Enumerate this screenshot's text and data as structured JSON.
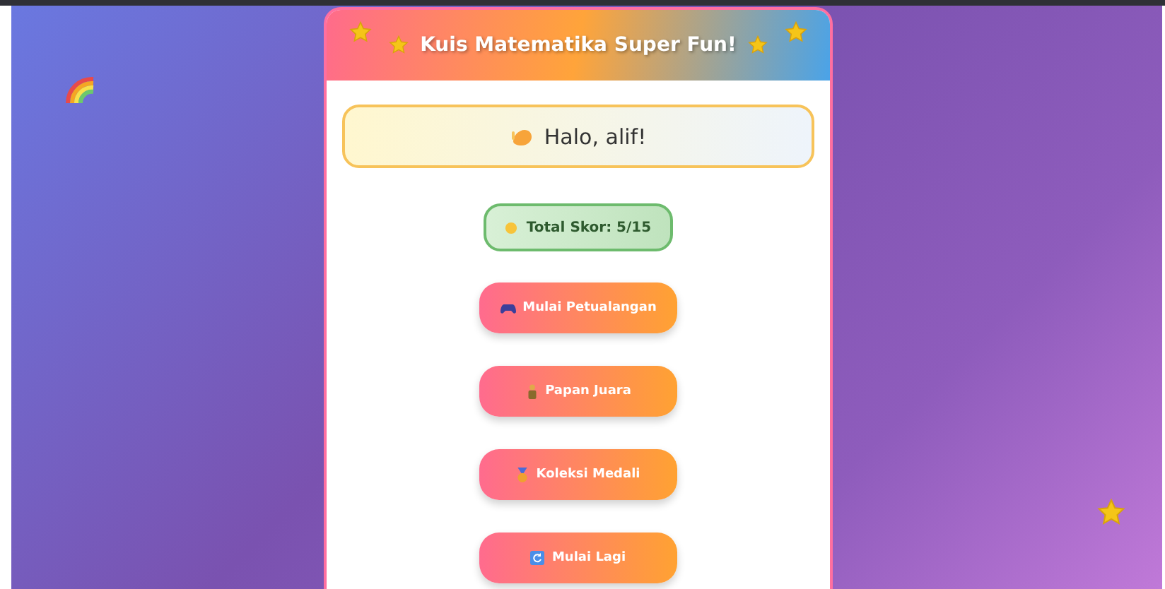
{
  "header": {
    "title": "Kuis Matematika Super Fun!"
  },
  "greeting": {
    "text": "Halo, alif!"
  },
  "score": {
    "text": "Total Skor: 5/15"
  },
  "buttons": [
    {
      "label": "Mulai Petualangan",
      "kind": "game"
    },
    {
      "label": "Papan Juara",
      "kind": "trophy"
    },
    {
      "label": "Koleksi Medali",
      "kind": "medal"
    },
    {
      "label": "Mulai Lagi",
      "kind": "restart"
    }
  ]
}
